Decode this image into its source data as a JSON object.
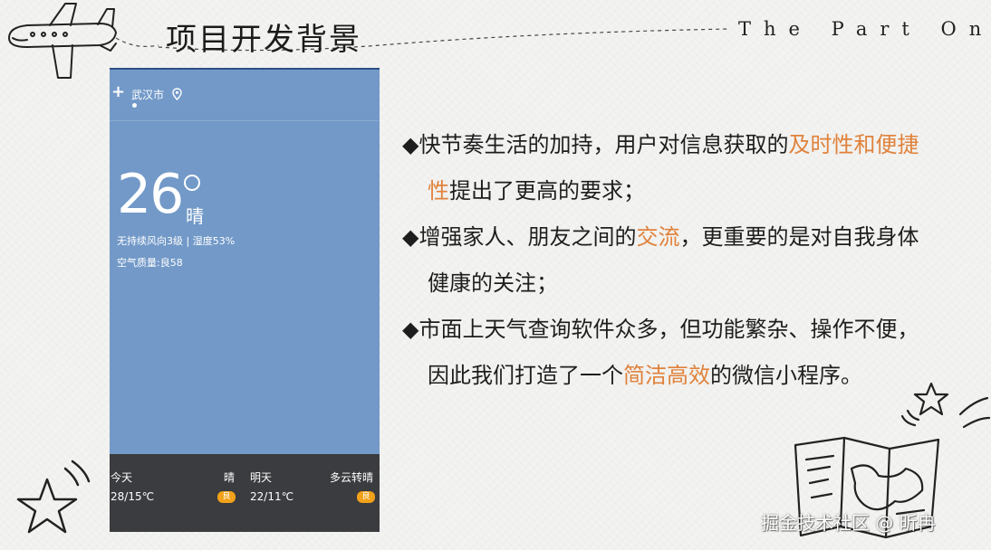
{
  "slide": {
    "title": "项目开发背景",
    "part_label": "The Part One"
  },
  "phone": {
    "add_icon": "+",
    "city": "武汉市",
    "temperature": "26",
    "condition": "晴",
    "wind_humidity": "无持续风向3级 | 湿度53%",
    "air_quality": "空气质量:良58",
    "forecast": [
      {
        "day": "今天",
        "weather": "晴",
        "temp": "28/15℃",
        "badge": "良"
      },
      {
        "day": "明天",
        "weather": "多云转晴",
        "temp": "22/11℃",
        "badge": "良"
      }
    ],
    "bg_color": "#7299c8",
    "badge_color": "#f2a21a"
  },
  "bullets": [
    {
      "bullet": "◆",
      "before": "快节奏生活的加持，用户对信息获取的",
      "highlight": "及时性和便捷性",
      "after": "提出了更高的要求；"
    },
    {
      "bullet": "◆",
      "before": "增强家人、朋友之间的",
      "highlight": "交流",
      "after": "，更重要的是对自我身体健康的关注；"
    },
    {
      "bullet": "◆",
      "before": "市面上天气查询软件众多，但功能繁杂、操作不便，因此我们打造了一个",
      "highlight": "简洁高效",
      "after": "的微信小程序。"
    }
  ],
  "highlight_color": "#e0823c",
  "watermark": "掘金技术社区 @ 昕冉",
  "icons": [
    "airplane-icon",
    "star-icon",
    "map-icon",
    "location-pin-icon",
    "plus-icon"
  ]
}
